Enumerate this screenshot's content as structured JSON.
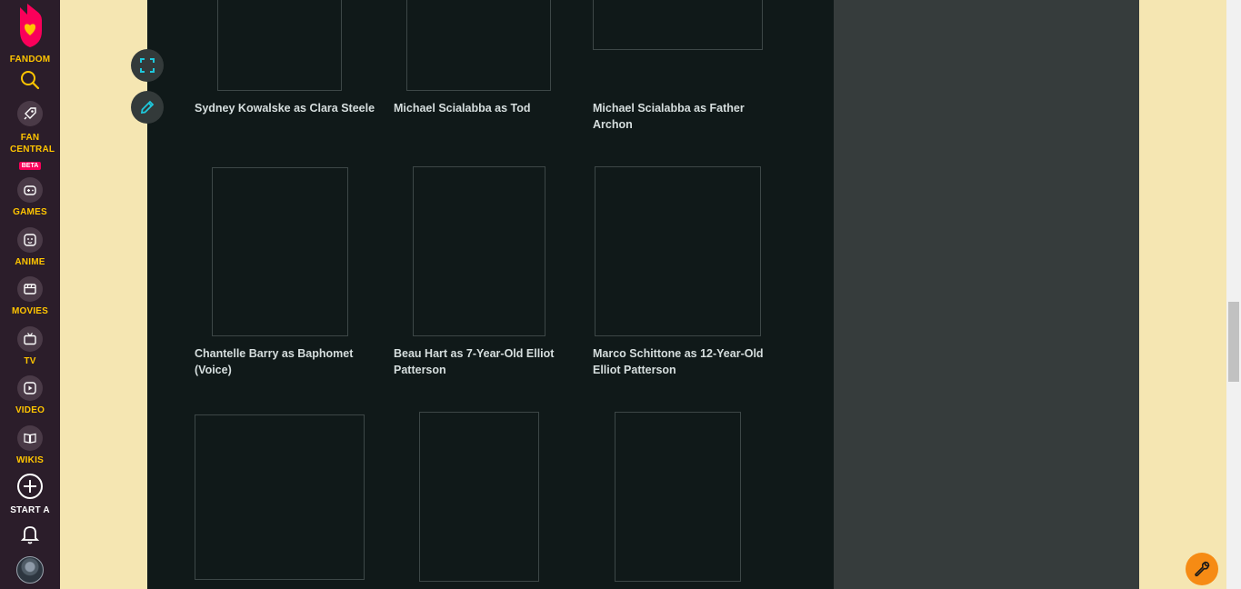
{
  "nav": {
    "brand": "FANDOM",
    "fan_central": "FAN CENTRAL",
    "beta": "BETA",
    "games": "GAMES",
    "anime": "ANIME",
    "movies": "MOVIES",
    "tv": "TV",
    "video": "VIDEO",
    "wikis": "WIKIS",
    "start_a": "START A"
  },
  "gallery": {
    "row1": [
      "Sydney Kowalske as Clara Steele",
      "Michael Scialabba as Tod",
      "Michael Scialabba as Father Archon"
    ],
    "row2": [
      "Chantelle Barry as Baphomet (Voice)",
      "Beau Hart as 7-Year-Old Elliot Patterson",
      "Marco Schittone as 12-Year-Old Elliot Patterson"
    ]
  },
  "colors": {
    "nav_bg": "#2b1d2a",
    "nav_accent": "#ffc500",
    "content_bg": "#101919",
    "rail_bg": "#363c3c",
    "page_bg": "#f5e6b2",
    "fab_accent": "#1ec8dc",
    "tools_button": "#f68b14"
  }
}
